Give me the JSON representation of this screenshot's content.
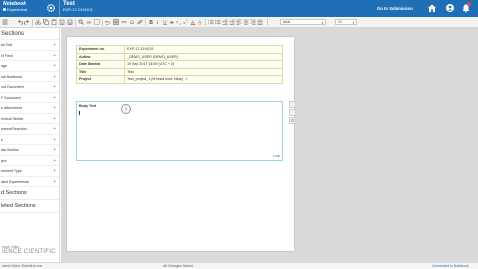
{
  "header": {
    "app_name": "Notebook",
    "app_sub": "Experiment",
    "title": "Test",
    "experiment_id": "EXP-17-CH4101",
    "submit_label": "Go to Submission"
  },
  "toolbar": {
    "font_value": "Arial",
    "size_value": "12"
  },
  "sidebar": {
    "heading": "Sections",
    "items": [
      {
        "label": "ds Test"
      },
      {
        "label": "xt Field"
      },
      {
        "label": "age"
      },
      {
        "label": "nal Notebook"
      },
      {
        "label": "ord Document"
      },
      {
        "label": "F Document"
      },
      {
        "label": "e attachment"
      },
      {
        "label": "emical Sketch"
      },
      {
        "label": "emical Reaction"
      },
      {
        "label": "e"
      },
      {
        "label": "ata Section"
      },
      {
        "label": "ject"
      },
      {
        "label": "eriment Type"
      },
      {
        "label": "ated Experiments"
      }
    ],
    "sections_label": "d Sections",
    "deleted_label": "leted Sections"
  },
  "fields": [
    {
      "label": "Experiment no.",
      "value": "EXP-17-CH4101"
    },
    {
      "label": "Author",
      "value": "_DEMO_USER (DEMO_USER)"
    },
    {
      "label": "Date Started",
      "value": "19 Sep 2017 14:59 (UTC + 2)"
    },
    {
      "label": "Title",
      "value": "Test"
    },
    {
      "label": "Project",
      "value": "Test_project_1 [M testa med. Nina]"
    }
  ],
  "body_text": {
    "label": "Body Text",
    "lock_label": "Lock",
    "step_number": "1"
  },
  "status": {
    "left": "ment Video: Submit to me",
    "middle": "All Changes Saved",
    "right": "Connected to Notebook"
  },
  "watermark": {
    "small": "ence Video",
    "big": "IENCE  CIENTIFIC"
  }
}
